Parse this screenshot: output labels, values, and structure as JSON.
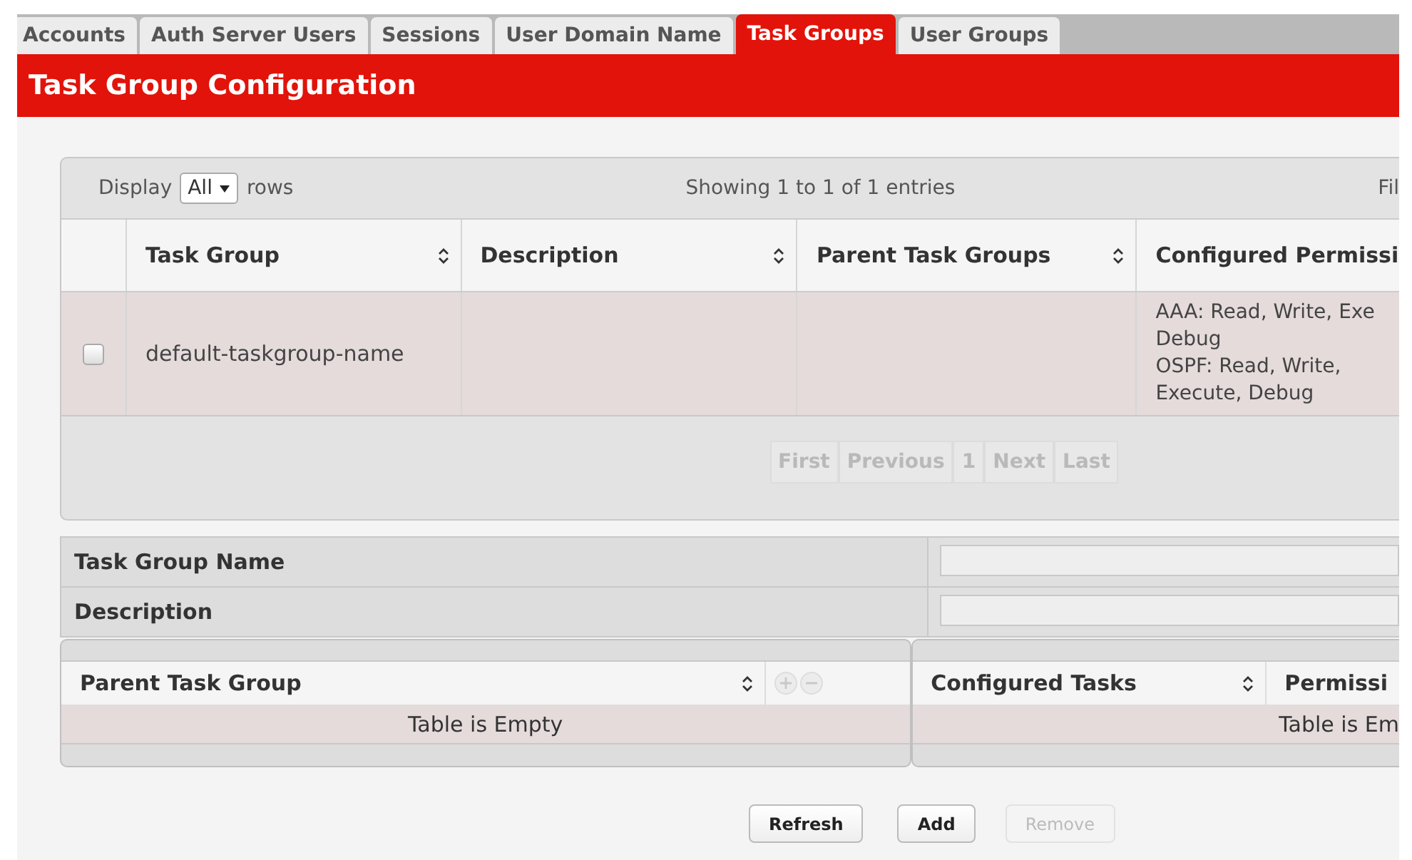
{
  "tabs": [
    {
      "label": "Accounts",
      "selected": false
    },
    {
      "label": "Auth Server Users",
      "selected": false
    },
    {
      "label": "Sessions",
      "selected": false
    },
    {
      "label": "User Domain Name",
      "selected": false
    },
    {
      "label": "Task Groups",
      "selected": true
    },
    {
      "label": "User Groups",
      "selected": false
    }
  ],
  "page_title": "Task Group Configuration",
  "table": {
    "display_label": "Display",
    "page_size": "All",
    "rows_label": "rows",
    "showing": "Showing 1 to 1 of 1 entries",
    "filter_label": "Fil",
    "columns": [
      {
        "label": "Task Group",
        "sortable": true
      },
      {
        "label": "Description",
        "sortable": true
      },
      {
        "label": "Parent Task Groups",
        "sortable": true
      },
      {
        "label": "Configured Permissi"
      }
    ],
    "rows": [
      {
        "checked": false,
        "cells": [
          [
            "default-taskgroup-name"
          ],
          [],
          [],
          [
            "AAA: Read, Write, Exe",
            "Debug",
            "OSPF: Read, Write,",
            "Execute, Debug"
          ]
        ]
      }
    ],
    "pagination": [
      {
        "label": "First",
        "disabled": true
      },
      {
        "label": "Previous",
        "disabled": true
      },
      {
        "label": "1",
        "disabled": true
      },
      {
        "label": "Next",
        "disabled": true
      },
      {
        "label": "Last",
        "disabled": true
      }
    ]
  },
  "form": [
    {
      "label": "Task Group Name"
    },
    {
      "label": "Description"
    }
  ],
  "parent_table": {
    "columns": [
      {
        "label": "Parent Task Group",
        "sortable": true
      }
    ],
    "empty": "Table is Empty"
  },
  "tasks_table": {
    "columns": [
      {
        "label": "Configured Tasks",
        "sortable": true
      },
      {
        "label": "Permissi"
      }
    ],
    "empty": "Table is Em"
  },
  "buttons": [
    {
      "label": "Refresh",
      "disabled": false
    },
    {
      "label": "Add",
      "disabled": false
    },
    {
      "label": "Remove",
      "disabled": true
    }
  ]
}
